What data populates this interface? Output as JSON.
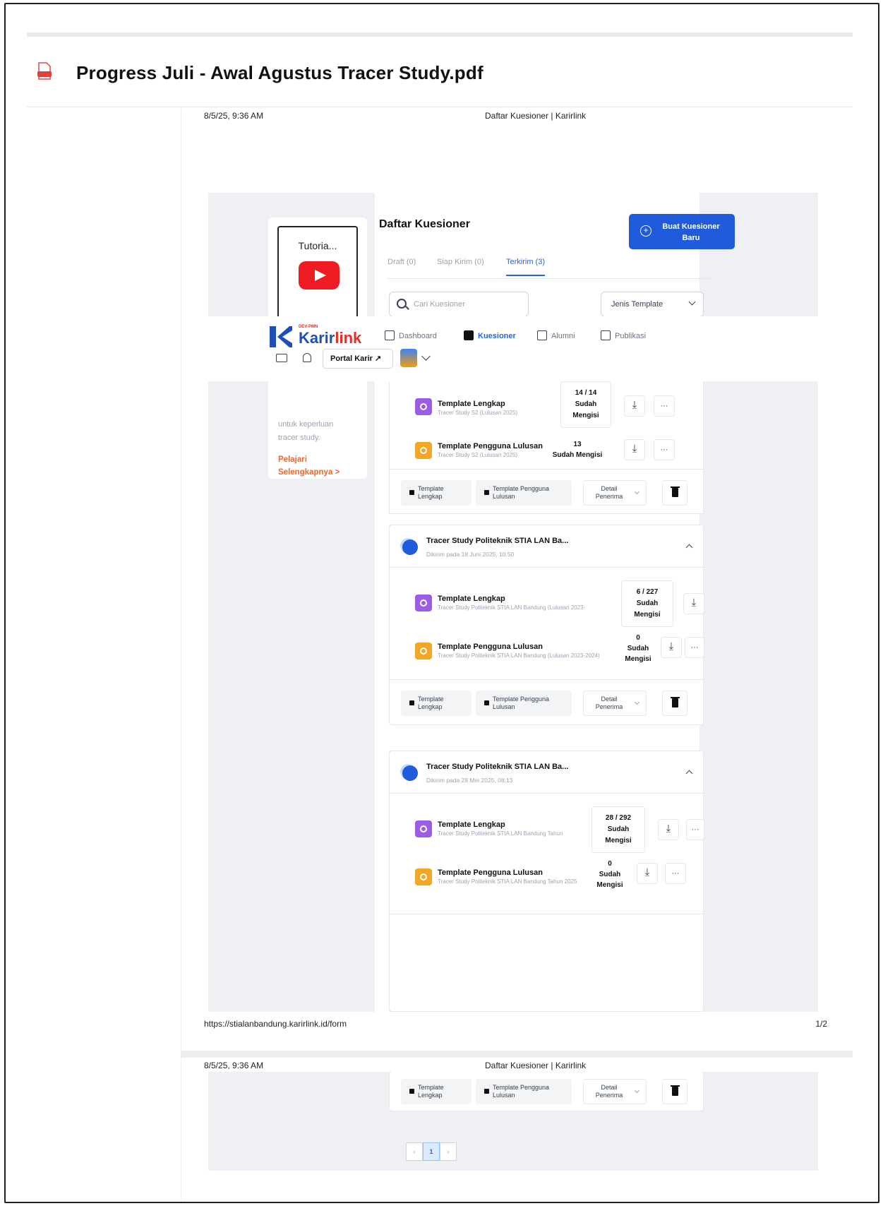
{
  "file": {
    "title": "Progress Juli - Awal Agustus Tracer Study.pdf"
  },
  "page1": {
    "header_date": "8/5/25, 9:36 AM",
    "header_title": "Daftar Kuesioner | Karirlink",
    "footer_url": "https://stialanbandung.karirlink.id/form",
    "footer_page": "1/2"
  },
  "page2": {
    "header_date": "8/5/25, 9:36 AM",
    "header_title": "Daftar Kuesioner | Karirlink"
  },
  "tutorial": {
    "thumb_title": "Tutoria...",
    "desc_line1": "untuk keperluan",
    "desc_line2": "tracer study.",
    "link_line1": "Pelajari",
    "link_line2": "Selengkapnya  >"
  },
  "main": {
    "title": "Daftar Kuesioner",
    "new_button_line1": "Buat Kuesioner",
    "new_button_line2": "Baru",
    "tabs": [
      "Draft (0)",
      "Siap Kirim (0)",
      "Terkirim (3)"
    ],
    "search_placeholder": "Cari Kuesioner",
    "filter_label": "Jenis Template"
  },
  "nav": {
    "logo_sub": "DEV-PMN",
    "logo_a": "Karir",
    "logo_b": "link",
    "items": [
      "Dashboard",
      "Kuesioner",
      "Alumni",
      "Publikasi"
    ],
    "portal": "Portal Karir ↗"
  },
  "group0": {
    "rows": [
      {
        "name": "Template Lengkap",
        "sub": "Tracer Study S2 (Lulusan 2025)",
        "c1": "14 / 14",
        "c2": "Sudah",
        "c3": "Mengisi"
      },
      {
        "name": "Template Pengguna Lulusan",
        "sub": "Tracer Study S2 (Lulusan 2025)",
        "c1": "13",
        "c2": "Sudah Mengisi"
      }
    ]
  },
  "footer_chips": {
    "chip1_a": "Template",
    "chip1_b": "Lengkap",
    "chip2_a": "Template Pengguna",
    "chip2_b": "Lulusan",
    "detail_a": "Detail",
    "detail_b": "Penerima"
  },
  "group1": {
    "name": "Tracer Study Politeknik STIA LAN Ba...",
    "date": "Dikirim pada 18 Juni 2025, 10:50",
    "rows": [
      {
        "name": "Template Lengkap",
        "sub": "Tracer Study Politeknik STIA LAN Bandung (Lulusan 2023-",
        "c1": "6 / 227",
        "c2": "Sudah",
        "c3": "Mengisi"
      },
      {
        "name": "Template Pengguna Lulusan",
        "sub": "Tracer Study Politeknik STIA LAN Bandung (Lulusan 2023-2024)",
        "c1": "0",
        "c2": "Sudah",
        "c3": "Mengisi"
      }
    ]
  },
  "group2": {
    "name": "Tracer Study Politeknik STIA LAN Ba...",
    "date": "Dikirim pada 28 Mei 2025, 08:13",
    "rows": [
      {
        "name": "Template Lengkap",
        "sub": "Tracer Study Politeknik STIA LAN Bandung Tahun",
        "c1": "28 / 292",
        "c2": "Sudah",
        "c3": "Mengisi"
      },
      {
        "name": "Template Pengguna Lulusan",
        "sub": "Tracer Study Politeknik STIA LAN Bandung Tahun 2025",
        "c1": "0",
        "c2": "Sudah",
        "c3": "Mengisi"
      }
    ]
  },
  "pager": {
    "prev": "‹",
    "current": "1",
    "next": "›"
  }
}
